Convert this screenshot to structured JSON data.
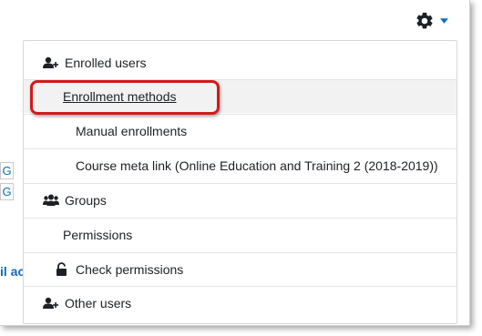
{
  "colors": {
    "accent": "#0f6cbf",
    "highlight": "#d11a1a",
    "text": "#1d2125",
    "hover_bg": "#f2f2f2"
  },
  "header": {
    "settings_icon": "gear-icon",
    "caret_icon": "caret-down-icon"
  },
  "background": {
    "letters": [
      "G",
      "G"
    ],
    "partial_link": "il ac"
  },
  "menu": {
    "items": [
      {
        "label": "Enrolled users",
        "icon": "user-plus-icon"
      },
      {
        "label": "Enrollment methods",
        "highlighted": true
      },
      {
        "label": "Manual enrollments"
      },
      {
        "label": "Course meta link (Online Education and Training 2 (2018-2019))"
      },
      {
        "label": "Groups",
        "icon": "users-icon"
      },
      {
        "label": "Permissions"
      },
      {
        "label": "Check permissions",
        "icon": "unlock-icon"
      },
      {
        "label": "Other users",
        "icon": "user-plus-icon"
      }
    ]
  }
}
